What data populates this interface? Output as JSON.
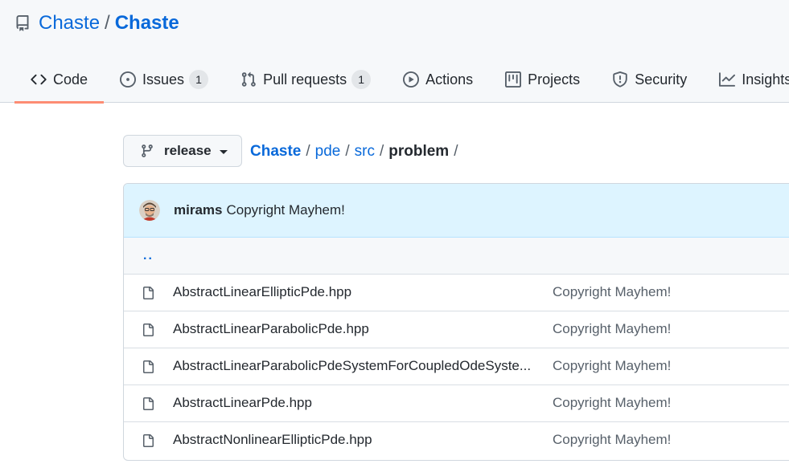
{
  "repo": {
    "owner": "Chaste",
    "separator": "/",
    "name": "Chaste"
  },
  "tabs": [
    {
      "label": "Code",
      "icon": "code-icon",
      "selected": true
    },
    {
      "label": "Issues",
      "icon": "issue-opened-icon",
      "count": "1"
    },
    {
      "label": "Pull requests",
      "icon": "git-pull-request-icon",
      "count": "1"
    },
    {
      "label": "Actions",
      "icon": "play-icon"
    },
    {
      "label": "Projects",
      "icon": "project-icon"
    },
    {
      "label": "Security",
      "icon": "shield-icon"
    },
    {
      "label": "Insights",
      "icon": "graph-icon"
    }
  ],
  "branch": {
    "label": "release",
    "icon": "git-branch-icon"
  },
  "breadcrumb": {
    "root": "Chaste",
    "parts": [
      "pde",
      "src"
    ],
    "current": "problem",
    "separator": "/"
  },
  "latest_commit": {
    "author": "mirams",
    "message": "Copyright Mayhem!"
  },
  "parent_dir": "..",
  "files": [
    {
      "name": "AbstractLinearEllipticPde.hpp",
      "commit": "Copyright Mayhem!"
    },
    {
      "name": "AbstractLinearParabolicPde.hpp",
      "commit": "Copyright Mayhem!"
    },
    {
      "name": "AbstractLinearParabolicPdeSystemForCoupledOdeSyste...",
      "commit": "Copyright Mayhem!"
    },
    {
      "name": "AbstractLinearPde.hpp",
      "commit": "Copyright Mayhem!"
    },
    {
      "name": "AbstractNonlinearEllipticPde.hpp",
      "commit": "Copyright Mayhem!"
    }
  ],
  "colors": {
    "link": "#0969da",
    "tab_underline": "#fd8c73",
    "commit_bar": "#ddf4ff"
  }
}
